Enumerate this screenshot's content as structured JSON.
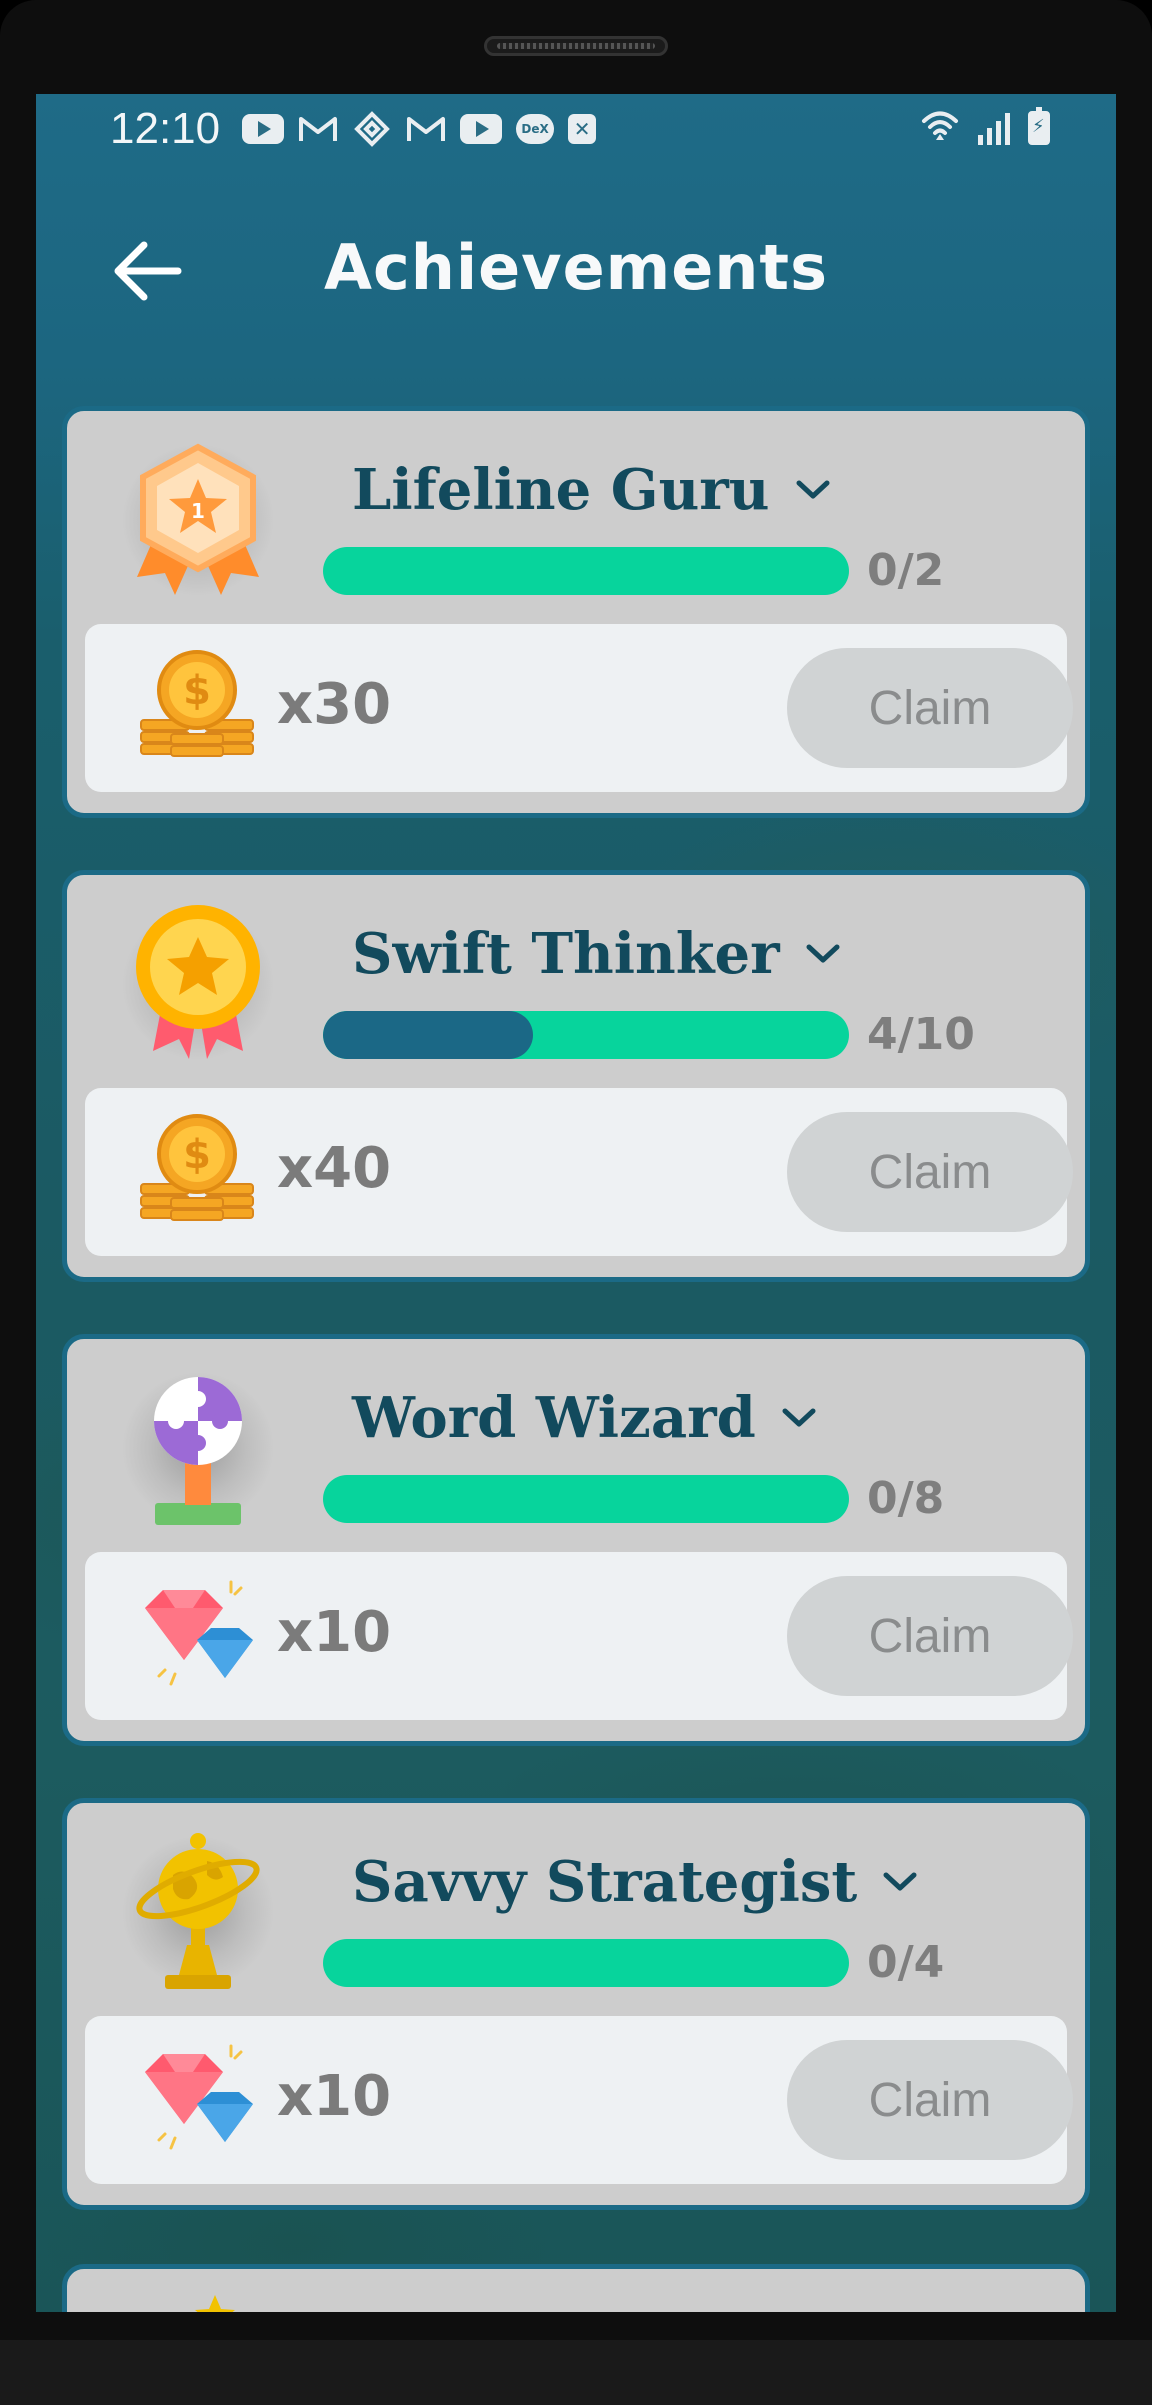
{
  "status_bar": {
    "time": "12:10",
    "notification_icons": [
      "youtube-icon",
      "gmail-icon",
      "binance-icon",
      "gmail-icon",
      "youtube-icon",
      "dex-icon",
      "xbox-icon"
    ],
    "dex_label": "DeX"
  },
  "header": {
    "title": "Achievements",
    "back_icon": "arrow-left-icon"
  },
  "achievements": [
    {
      "name": "Lifeline Guru",
      "badge_icon": "star-shield-badge-icon",
      "progress_current": 0,
      "progress_total": 2,
      "progress_text": "0/2",
      "reward_icon": "coins-icon",
      "reward_amount": "x30",
      "claim_label": "Claim"
    },
    {
      "name": "Swift Thinker",
      "badge_icon": "gold-medal-icon",
      "progress_current": 4,
      "progress_total": 10,
      "progress_text": "4/10",
      "reward_icon": "coins-icon",
      "reward_amount": "x40",
      "claim_label": "Claim"
    },
    {
      "name": "Word Wizard",
      "badge_icon": "puzzle-trophy-icon",
      "progress_current": 0,
      "progress_total": 8,
      "progress_text": "0/8",
      "reward_icon": "gems-icon",
      "reward_amount": "x10",
      "claim_label": "Claim"
    },
    {
      "name": "Savvy Strategist",
      "badge_icon": "globe-trophy-icon",
      "progress_current": 0,
      "progress_total": 4,
      "progress_text": "0/4",
      "reward_icon": "gems-icon",
      "reward_amount": "x10",
      "claim_label": "Claim"
    }
  ],
  "colors": {
    "progress_track": "#07d49c",
    "progress_fill": "#1b6886",
    "card_border": "#1b6a86",
    "title_text": "#124a5d"
  }
}
